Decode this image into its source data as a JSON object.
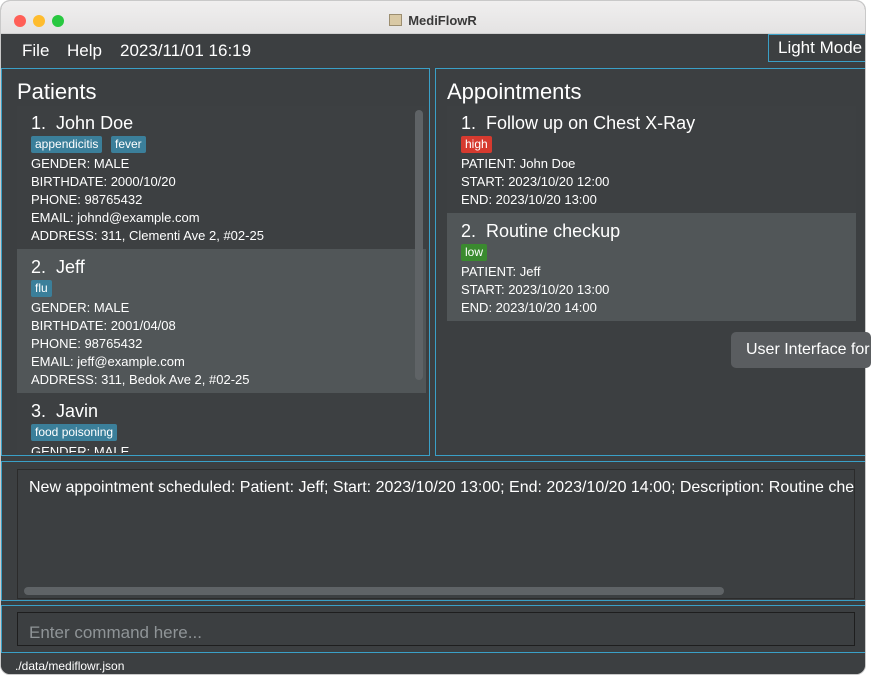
{
  "window": {
    "title": "MediFlowR"
  },
  "menu": {
    "file": "File",
    "help": "Help",
    "datetime": "2023/11/01 16:19",
    "mode_button": "Light Mode"
  },
  "patients": {
    "title": "Patients",
    "items": [
      {
        "index": "1.",
        "name": "John Doe",
        "tags": [
          "appendicitis",
          "fever"
        ],
        "gender": "GENDER: MALE",
        "birthdate": "BIRTHDATE: 2000/10/20",
        "phone": "PHONE: 98765432",
        "email": "EMAIL: johnd@example.com",
        "address": "ADDRESS: 311, Clementi Ave 2, #02-25"
      },
      {
        "index": "2.",
        "name": "Jeff",
        "tags": [
          "flu"
        ],
        "gender": "GENDER: MALE",
        "birthdate": "BIRTHDATE: 2001/04/08",
        "phone": "PHONE: 98765432",
        "email": "EMAIL: jeff@example.com",
        "address": "ADDRESS: 311, Bedok Ave 2, #02-25"
      },
      {
        "index": "3.",
        "name": "Javin",
        "tags": [
          "food poisoning"
        ],
        "gender": "GENDER: MALE"
      }
    ]
  },
  "appointments": {
    "title": "Appointments",
    "items": [
      {
        "index": "1.",
        "title": "Follow up on Chest X-Ray",
        "priority": "high",
        "patient": "PATIENT: John Doe",
        "start": "START: 2023/10/20 12:00",
        "end": "END: 2023/10/20 13:00"
      },
      {
        "index": "2.",
        "title": "Routine checkup",
        "priority": "low",
        "patient": "PATIENT: Jeff",
        "start": "START: 2023/10/20 13:00",
        "end": "END: 2023/10/20 14:00"
      }
    ]
  },
  "tooltip": "User Interface for",
  "result": "New appointment scheduled: Patient: Jeff; Start: 2023/10/20 13:00; End: 2023/10/20 14:00; Description: Routine checkup",
  "command": {
    "placeholder": "Enter command here...",
    "value": ""
  },
  "status": {
    "path": "./data/mediflowr.json"
  },
  "colors": {
    "accent": "#3aa0c7",
    "background": "#3c3f41",
    "tag": "#3b7f9a",
    "high": "#d63a2f",
    "low": "#3a8a2f"
  }
}
